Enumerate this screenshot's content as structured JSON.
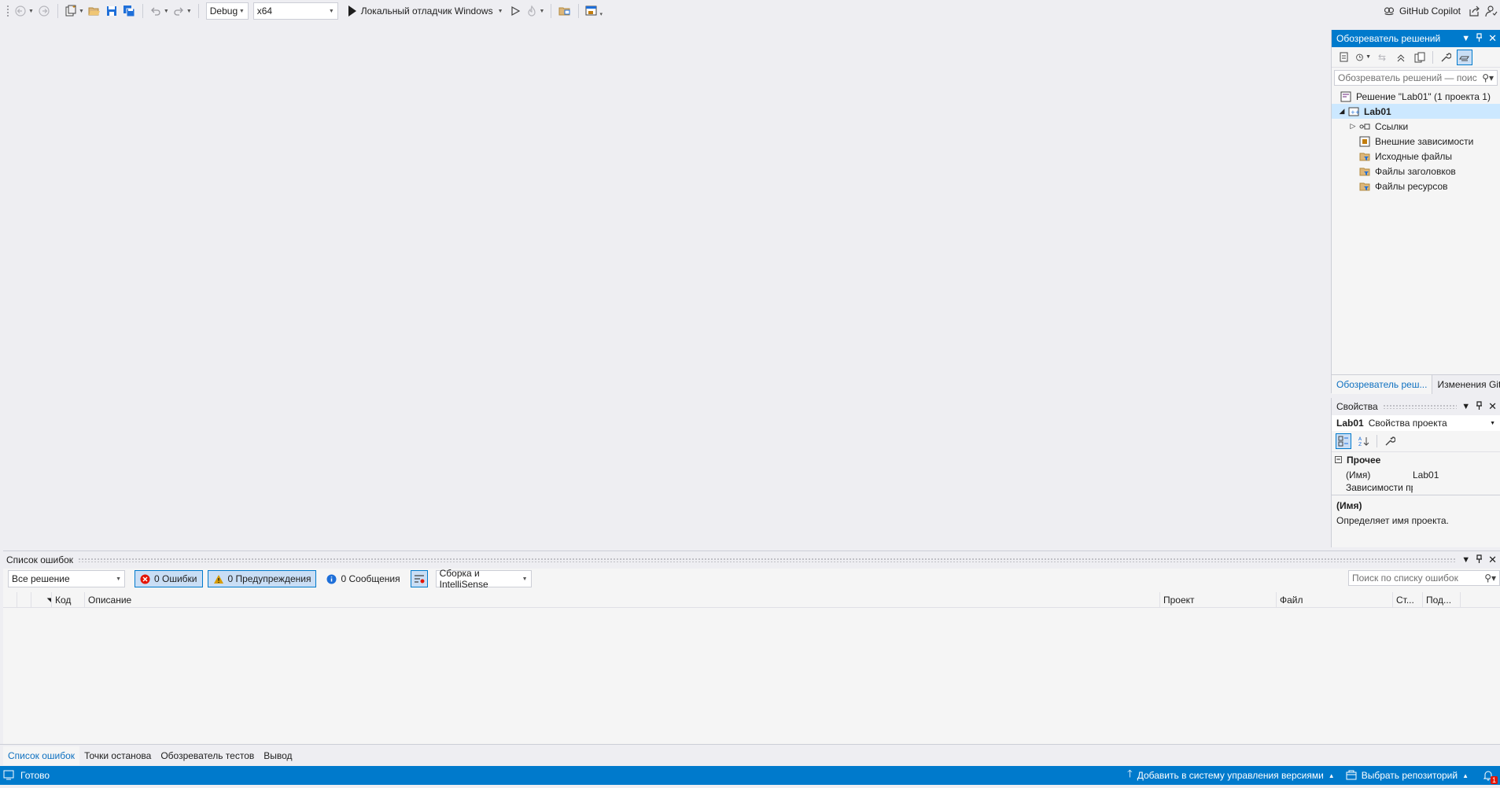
{
  "toolbar": {
    "config": "Debug",
    "platform": "x64",
    "run_label": "Локальный отладчик Windows",
    "copilot_label": "GitHub Copilot"
  },
  "solution_explorer": {
    "title": "Обозреватель решений",
    "search_placeholder": "Обозреватель решений — поиск (Ctrl+;)",
    "search_visible": "Обозреватель решений — поис",
    "tree": [
      {
        "label": "Решение \"Lab01\"  (1 проекта 1)",
        "icon": "solution-icon"
      },
      {
        "label": "Lab01",
        "icon": "project-icon"
      },
      {
        "label": "Ссылки",
        "icon": "references-icon"
      },
      {
        "label": "Внешние зависимости",
        "icon": "external-deps-icon"
      },
      {
        "label": "Исходные файлы",
        "icon": "filter-folder-icon"
      },
      {
        "label": "Файлы заголовков",
        "icon": "filter-folder-icon"
      },
      {
        "label": "Файлы ресурсов",
        "icon": "filter-folder-icon"
      }
    ],
    "tabs": [
      "Обозреватель реш...",
      "Изменения Git"
    ]
  },
  "properties": {
    "title": "Свойства",
    "object_name": "Lab01",
    "object_type": "Свойства проекта",
    "category": "Прочее",
    "rows": [
      {
        "key": "(Имя)",
        "value": "Lab01"
      },
      {
        "key": "Зависимости пр",
        "value": ""
      }
    ],
    "desc_title": "(Имя)",
    "desc_text": "Определяет имя проекта."
  },
  "error_list": {
    "title": "Список ошибок",
    "scope": "Все решение",
    "errors": "0 Ошибки",
    "warnings": "0 Предупреждения",
    "messages": "0 Сообщения",
    "source": "Сборка и IntelliSense",
    "search_placeholder": "Поиск по списку ошибок",
    "columns": [
      "Код",
      "Описание",
      "Проект",
      "Файл",
      "Ст...",
      "Под..."
    ]
  },
  "bottom_tabs": [
    "Список ошибок",
    "Точки останова",
    "Обозреватель тестов",
    "Вывод"
  ],
  "status": {
    "ready": "Готово",
    "add_to_source_control": "Добавить в систему управления версиями",
    "select_repository": "Выбрать репозиторий",
    "notifications": "1"
  },
  "colors": {
    "accent": "#007acc",
    "background": "#eeeef2",
    "panel": "#f5f5f5",
    "error": "#e51400",
    "warning": "#d89c00",
    "info": "#1e6fd9"
  }
}
